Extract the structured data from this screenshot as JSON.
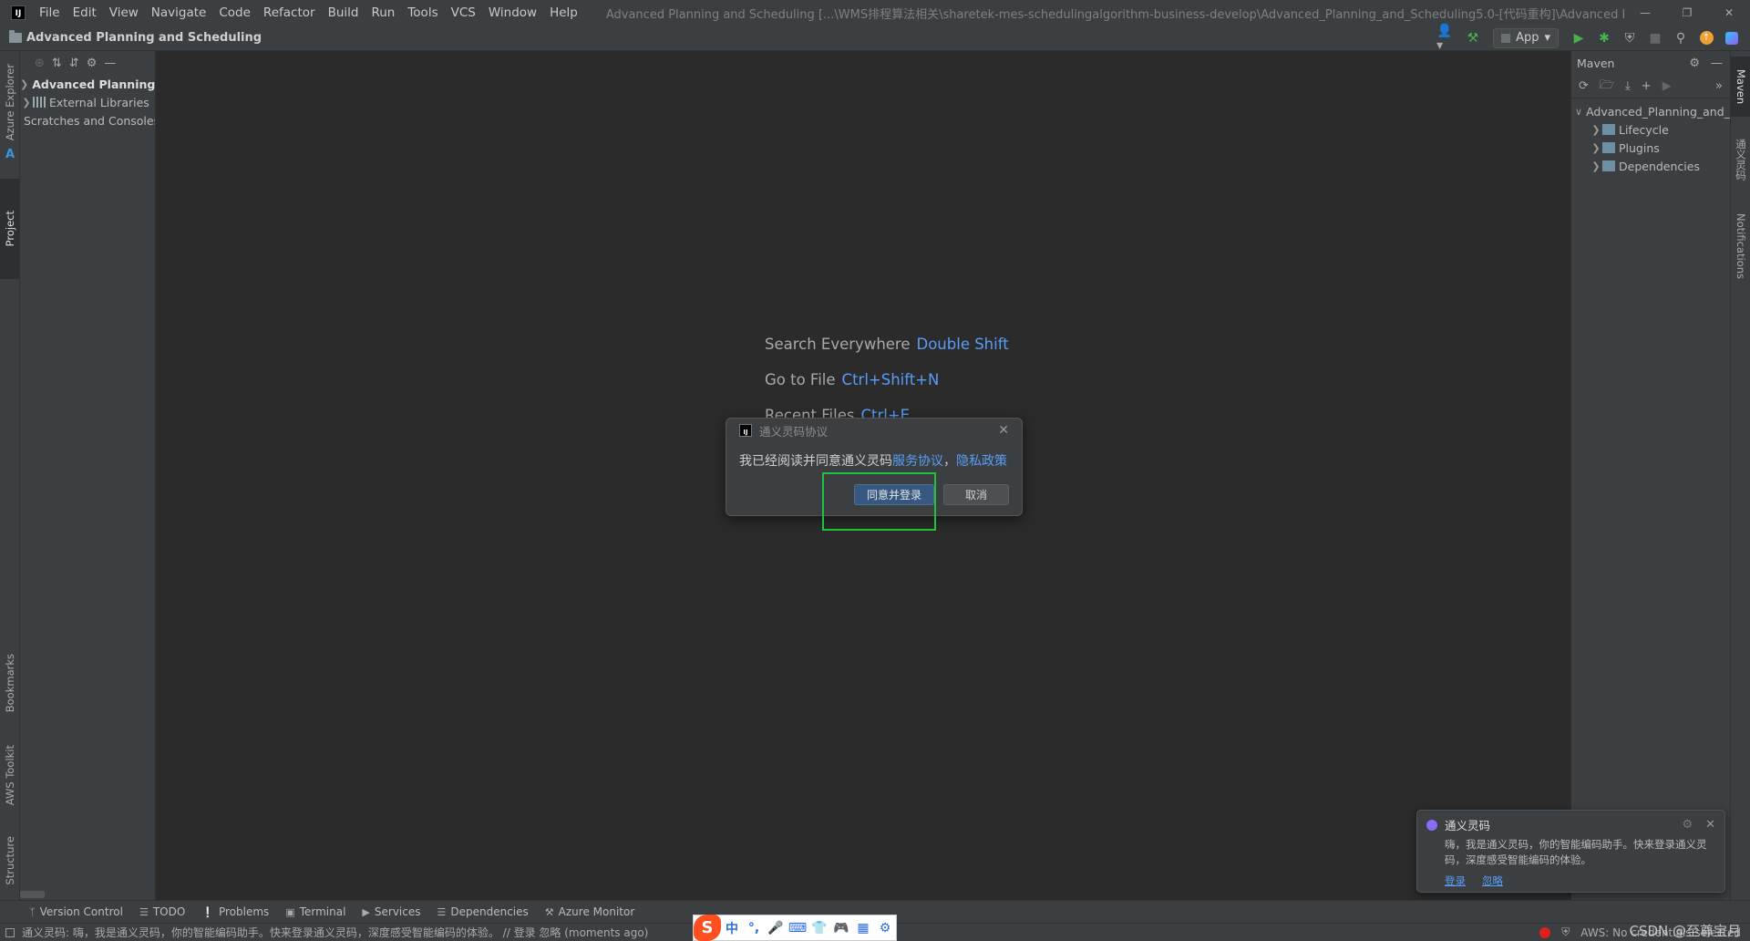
{
  "menubar": {
    "app_logo_text": "IJ",
    "items": [
      "File",
      "Edit",
      "View",
      "Navigate",
      "Code",
      "Refactor",
      "Build",
      "Run",
      "Tools",
      "VCS",
      "Window",
      "Help"
    ],
    "window_title": "Advanced Planning and Scheduling [...\\WMS排程算法相关\\sharetek-mes-schedulingalgorithm-business-develop\\Advanced_Planning_and_Scheduling5.0-[代码重构]\\Advanced Planning and Scheduling]"
  },
  "navbar": {
    "project_name": "Advanced Planning and Scheduling",
    "run_config": "App"
  },
  "left_stripe": {
    "tabs": [
      "Azure Explorer",
      "Project",
      "Bookmarks",
      "AWS Toolkit",
      "Structure"
    ]
  },
  "project_panel": {
    "items": [
      {
        "label": "Advanced Planning and Scheduling",
        "expanded": false
      },
      {
        "label": "External Libraries",
        "expanded": false
      },
      {
        "label": "Scratches and Consoles",
        "expanded": false
      }
    ]
  },
  "editor_hints": [
    {
      "label": "Search Everywhere",
      "key": "Double Shift"
    },
    {
      "label": "Go to File",
      "key": "Ctrl+Shift+N"
    },
    {
      "label": "Recent Files",
      "key": "Ctrl+E"
    }
  ],
  "dialog": {
    "logo_text": "IJ",
    "title": "通义灵码协议",
    "body_prefix": "我已经阅读并同意通义灵码",
    "link_service": "服务协议",
    "separator": "，",
    "link_privacy": "隐私政策",
    "agree_button": "同意并登录",
    "cancel_button": "取消",
    "highlight_color": "#1fc23a"
  },
  "maven_panel": {
    "title": "Maven",
    "root": "Advanced_Planning_and_Scheduling",
    "children": [
      "Lifecycle",
      "Plugins",
      "Dependencies"
    ]
  },
  "right_stripe": {
    "tabs": [
      "Maven",
      "通义灵码",
      "Notifications"
    ]
  },
  "notification": {
    "title": "通义灵码",
    "text": "嗨，我是通义灵码，你的智能编码助手。快来登录通义灵码，深度感受智能编码的体验。",
    "actions": [
      "登录",
      "忽略"
    ]
  },
  "bottom_tools": [
    "Version Control",
    "TODO",
    "Problems",
    "Terminal",
    "Services",
    "Dependencies",
    "Azure Monitor"
  ],
  "statusbar": {
    "message": "通义灵码: 嗨，我是通义灵码，你的智能编码助手。快来登录通义灵码，深度感受智能编码的体验。 // 登录   忽略 (moments ago)",
    "aws_status": "AWS: No credentials selected",
    "ime_items": [
      "中",
      "°,",
      "mic",
      "kbd",
      "shirt",
      "game",
      "apps",
      "gear"
    ],
    "watermark": "CSDN @至尊宝月"
  },
  "colors": {
    "accent_link": "#589df6",
    "primary_button": "#365880",
    "background": "#2b2b2b",
    "panel": "#3c3f41"
  }
}
